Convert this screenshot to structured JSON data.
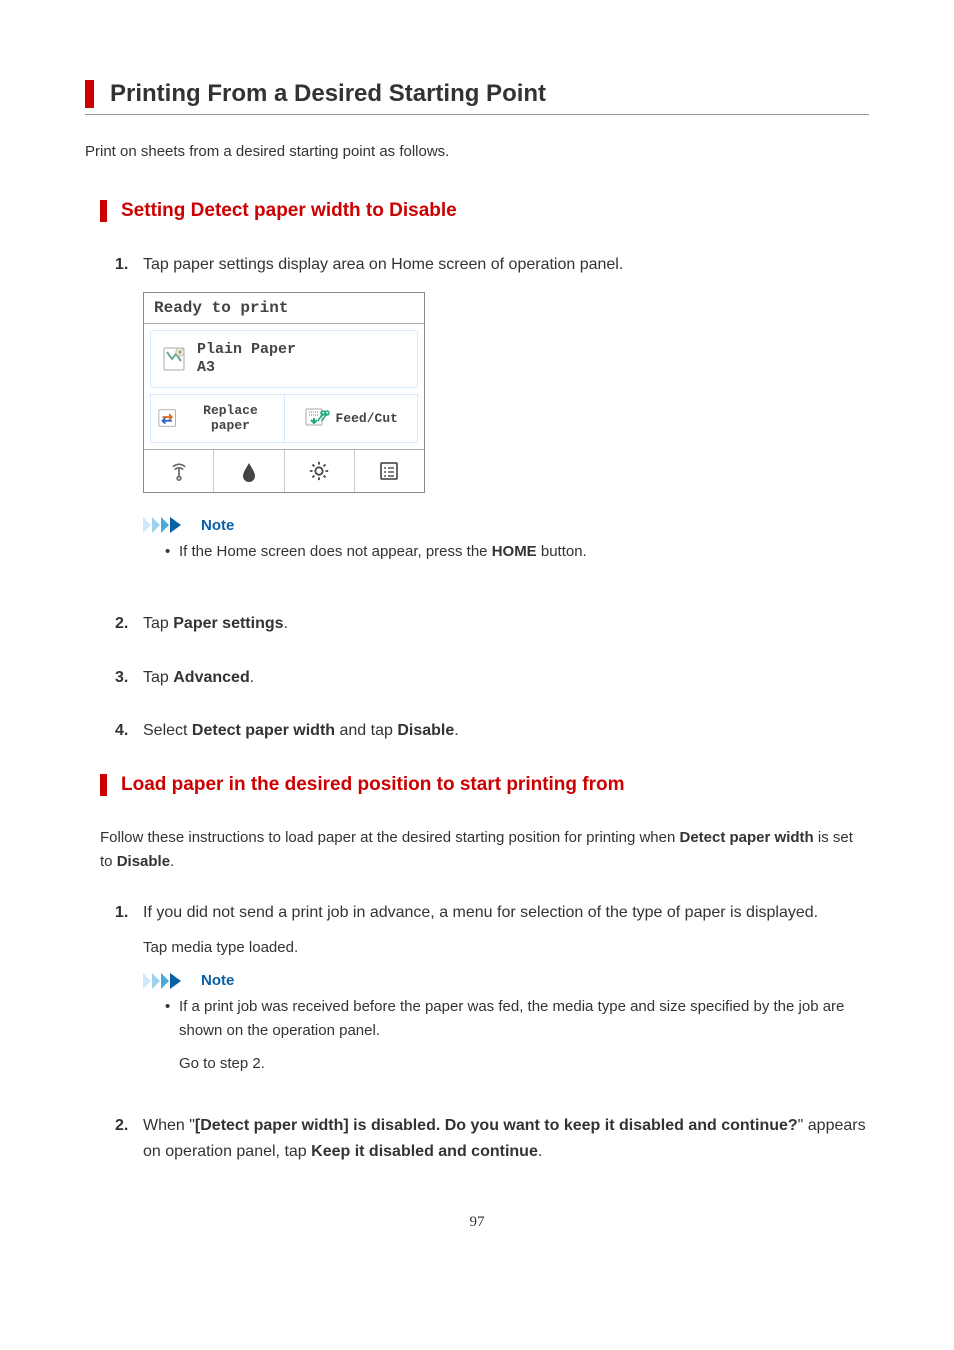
{
  "title": "Printing From a Desired Starting Point",
  "intro": "Print on sheets from a desired starting point as follows.",
  "section1": {
    "heading": "Setting Detect paper width to Disable",
    "step1_pre": "Tap paper settings display area on Home screen of operation panel.",
    "note_label": "Note",
    "note1_pre": "If the Home screen does not appear, press the ",
    "note1_bold": "HOME",
    "note1_post": " button.",
    "step2_pre": "Tap ",
    "step2_bold": "Paper settings",
    "step2_post": ".",
    "step3_pre": "Tap ",
    "step3_bold": "Advanced",
    "step3_post": ".",
    "step4_pre": "Select ",
    "step4_b1": "Detect paper width",
    "step4_mid": " and tap ",
    "step4_b2": "Disable",
    "step4_post": "."
  },
  "screen": {
    "status": "Ready to print",
    "paper_type": "Plain Paper",
    "paper_size": "A3",
    "replace": "Replace paper",
    "feedcut": "Feed/Cut"
  },
  "section2": {
    "heading": "Load paper in the desired position to start printing from",
    "intro_pre": "Follow these instructions to load paper at the desired starting position for printing when ",
    "intro_b1": "Detect paper width",
    "intro_mid": " is set to ",
    "intro_b2": "Disable",
    "intro_post": ".",
    "step1_text": "If you did not send a print job in advance, a menu for selection of the type of paper is displayed.",
    "step1_sub": "Tap media type loaded.",
    "note_label": "Note",
    "note1_text": "If a print job was received before the paper was fed, the media type and size specified by the job are shown on the operation panel.",
    "note1_sub": "Go to step 2.",
    "step2_pre": "When \"",
    "step2_b1": "[Detect paper width] is disabled. Do you want to keep it disabled and continue?",
    "step2_mid": "\" appears on operation panel, tap ",
    "step2_b2": "Keep it disabled and continue",
    "step2_post": "."
  },
  "nums": {
    "n1": "1.",
    "n2": "2.",
    "n3": "3.",
    "n4": "4."
  },
  "page_number": "97"
}
